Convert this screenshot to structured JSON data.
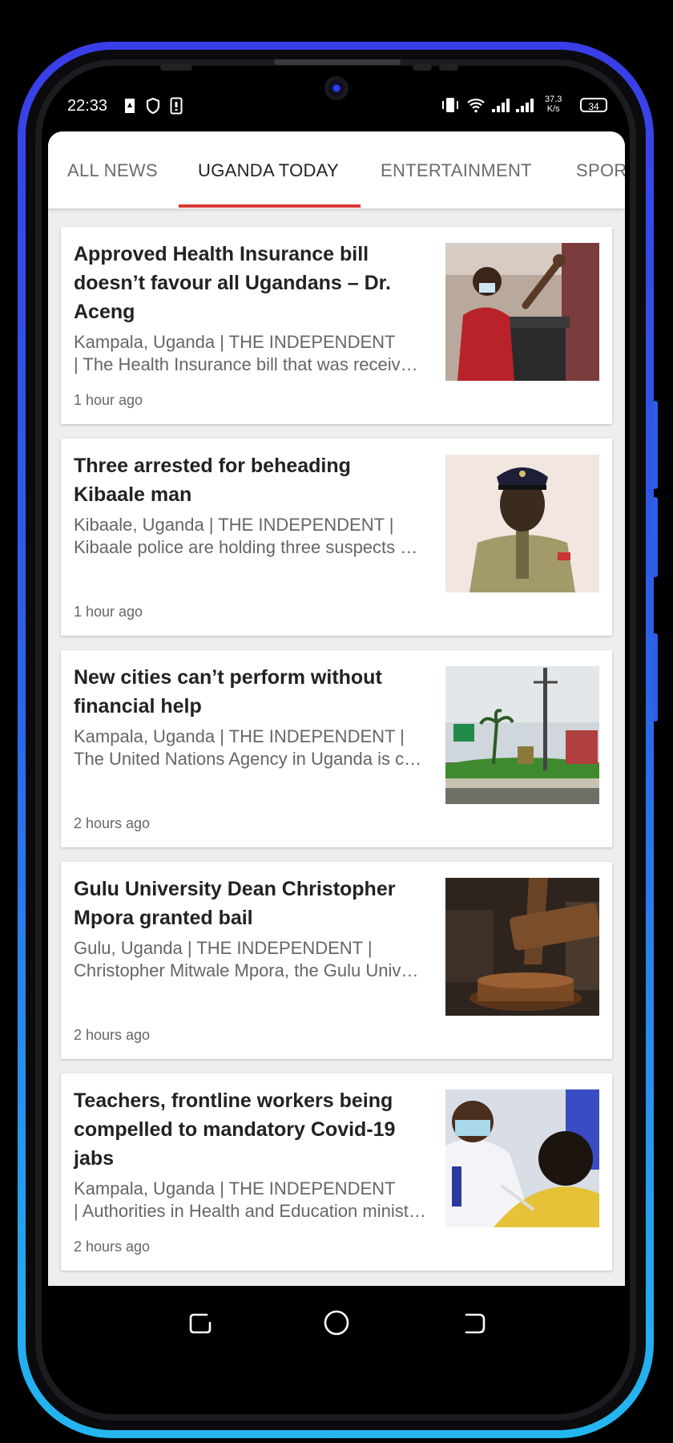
{
  "status_bar": {
    "time": "22:33",
    "net_speed_value": "37.3",
    "net_speed_unit": "K/s",
    "battery": "34"
  },
  "tabs": [
    {
      "label": "ALL NEWS",
      "active": false
    },
    {
      "label": "UGANDA TODAY",
      "active": true
    },
    {
      "label": "ENTERTAINMENT",
      "active": false
    },
    {
      "label": "SPOR",
      "active": false
    }
  ],
  "accent_color": "#d93a34",
  "articles": [
    {
      "title": "Approved Health Insurance bill doesn’t favour all Ugandans – Dr. Aceng",
      "excerpt_line1": "Kampala, Uganda | THE INDEPENDENT",
      "excerpt_line2": "| The Health Insurance bill that was received by cabinet",
      "time": "1 hour ago"
    },
    {
      "title": "Three arrested for beheading Kibaale man",
      "excerpt_line1": "Kibaale, Uganda | THE INDEPENDENT |",
      "excerpt_line2": "Kibaale police are holding three suspects over",
      "time": "1 hour ago"
    },
    {
      "title": "New cities can’t perform without financial help",
      "excerpt_line1": "Kampala, Uganda | THE INDEPENDENT |",
      "excerpt_line2": "The United Nations Agency in Uganda is calling",
      "time": "2 hours ago"
    },
    {
      "title": "Gulu University Dean Christopher Mpora granted bail",
      "excerpt_line1": "Gulu, Uganda | THE INDEPENDENT |",
      "excerpt_line2": "Christopher Mitwale Mpora, the Gulu University dean",
      "time": "2 hours ago"
    },
    {
      "title": "Teachers, frontline workers being compelled to mandatory Covid-19 jabs",
      "excerpt_line1": "Kampala, Uganda | THE INDEPENDENT",
      "excerpt_line2": "| Authorities in Health and Education ministries",
      "time": "2 hours ago"
    }
  ],
  "nav_icons": [
    "recent-apps-icon",
    "home-icon",
    "back-icon"
  ]
}
